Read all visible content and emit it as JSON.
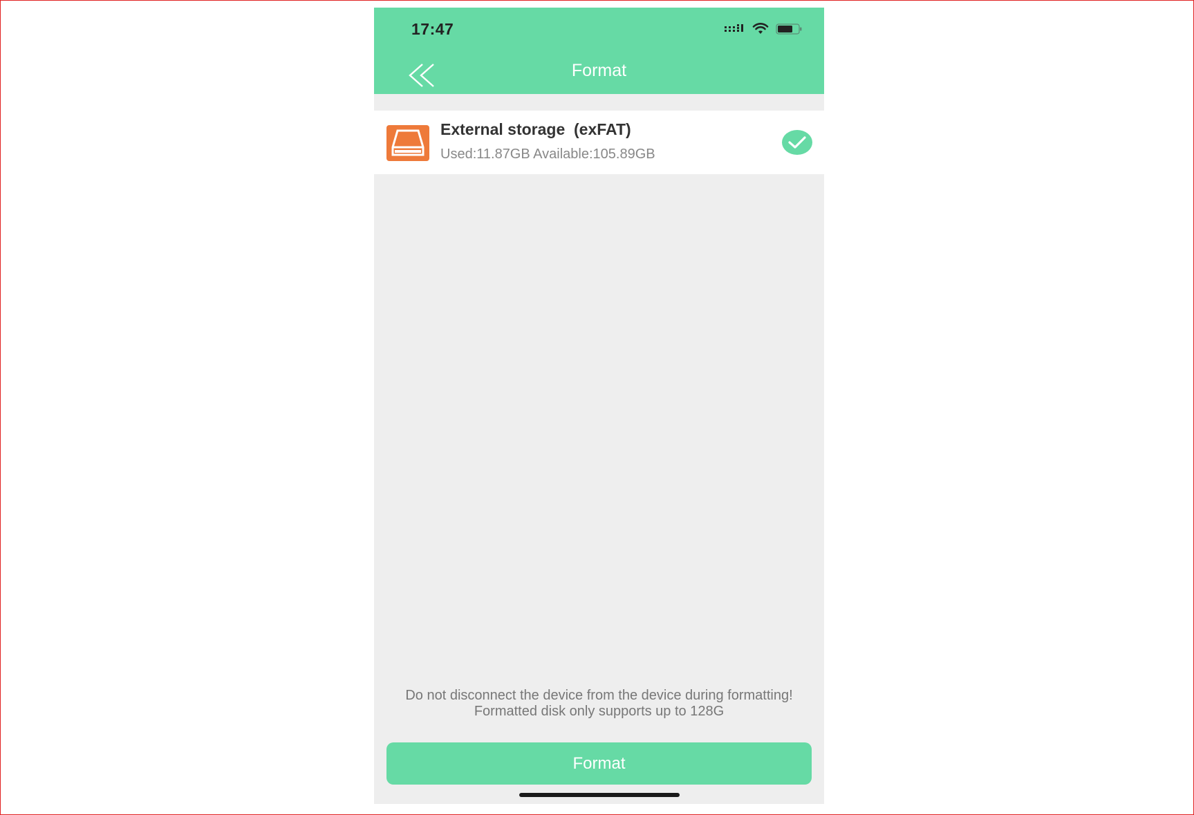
{
  "status_bar": {
    "time": "17:47",
    "icons": [
      "signal-icon",
      "wifi-icon",
      "battery-icon"
    ]
  },
  "header": {
    "title": "Format",
    "back_icon": "double-chevron-left-icon"
  },
  "storage": {
    "name": "External storage  (exFAT)",
    "usage": "Used:11.87GB Available:105.89GB",
    "selected": true,
    "icon": "disk-icon"
  },
  "notice": {
    "line1": "Do not disconnect the device from the device during formatting!",
    "line2": "Formatted disk only supports up to 128G"
  },
  "actions": {
    "format_label": "Format"
  },
  "colors": {
    "accent": "#66daa5",
    "background": "#eeeeee",
    "disk_icon": "#ee7a3a",
    "frame_border": "#e02020"
  }
}
